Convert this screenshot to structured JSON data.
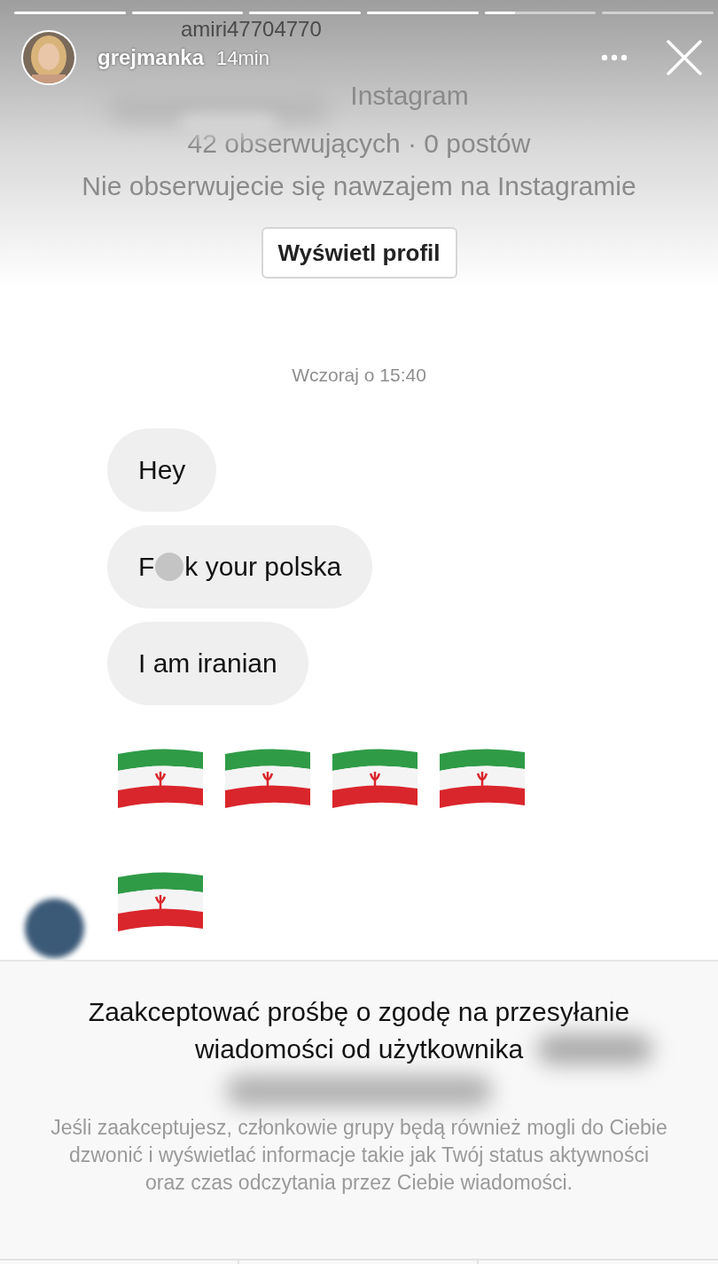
{
  "story": {
    "progress": [
      {
        "level": 1
      },
      {
        "level": 1
      },
      {
        "level": 1
      },
      {
        "level": 1
      },
      {
        "level": 0.27
      },
      {
        "level": 0
      }
    ],
    "viewer_label": "amiri47704770",
    "author": "grejmanka",
    "time": "14min"
  },
  "profile": {
    "name_suffix": "Instagram",
    "stats": "42 obserwujących · 0 postów",
    "relation": "Nie obserwujecie się nawzajem na Instagramie",
    "button": "Wyświetl profil"
  },
  "timestamp": "Wczoraj o 15:40",
  "messages": [
    {
      "kind": "text",
      "text": "Hey"
    },
    {
      "kind": "censored",
      "before": "F",
      "after": "k your polska"
    },
    {
      "kind": "text",
      "text": "I am iranian"
    },
    {
      "kind": "flags",
      "flags": [
        {
          "kind": "iran"
        },
        {
          "kind": "iran"
        },
        {
          "kind": "iran"
        },
        {
          "kind": "iran"
        }
      ],
      "avatar": false
    },
    {
      "kind": "flags",
      "flags": [
        {
          "kind": "iran"
        }
      ],
      "avatar": true
    }
  ],
  "request": {
    "title_lines": [
      "Zaakceptować prośbę o zgodę na przesyłanie",
      "wiadomości od użytkownika"
    ],
    "note": "Jeśli zaakceptujesz, członkowie grupy będą również mogli do Ciebie dzwonić i wyświetlać informacje takie jak Twój status aktywności oraz czas odczytania przez Ciebie wiadomości."
  }
}
